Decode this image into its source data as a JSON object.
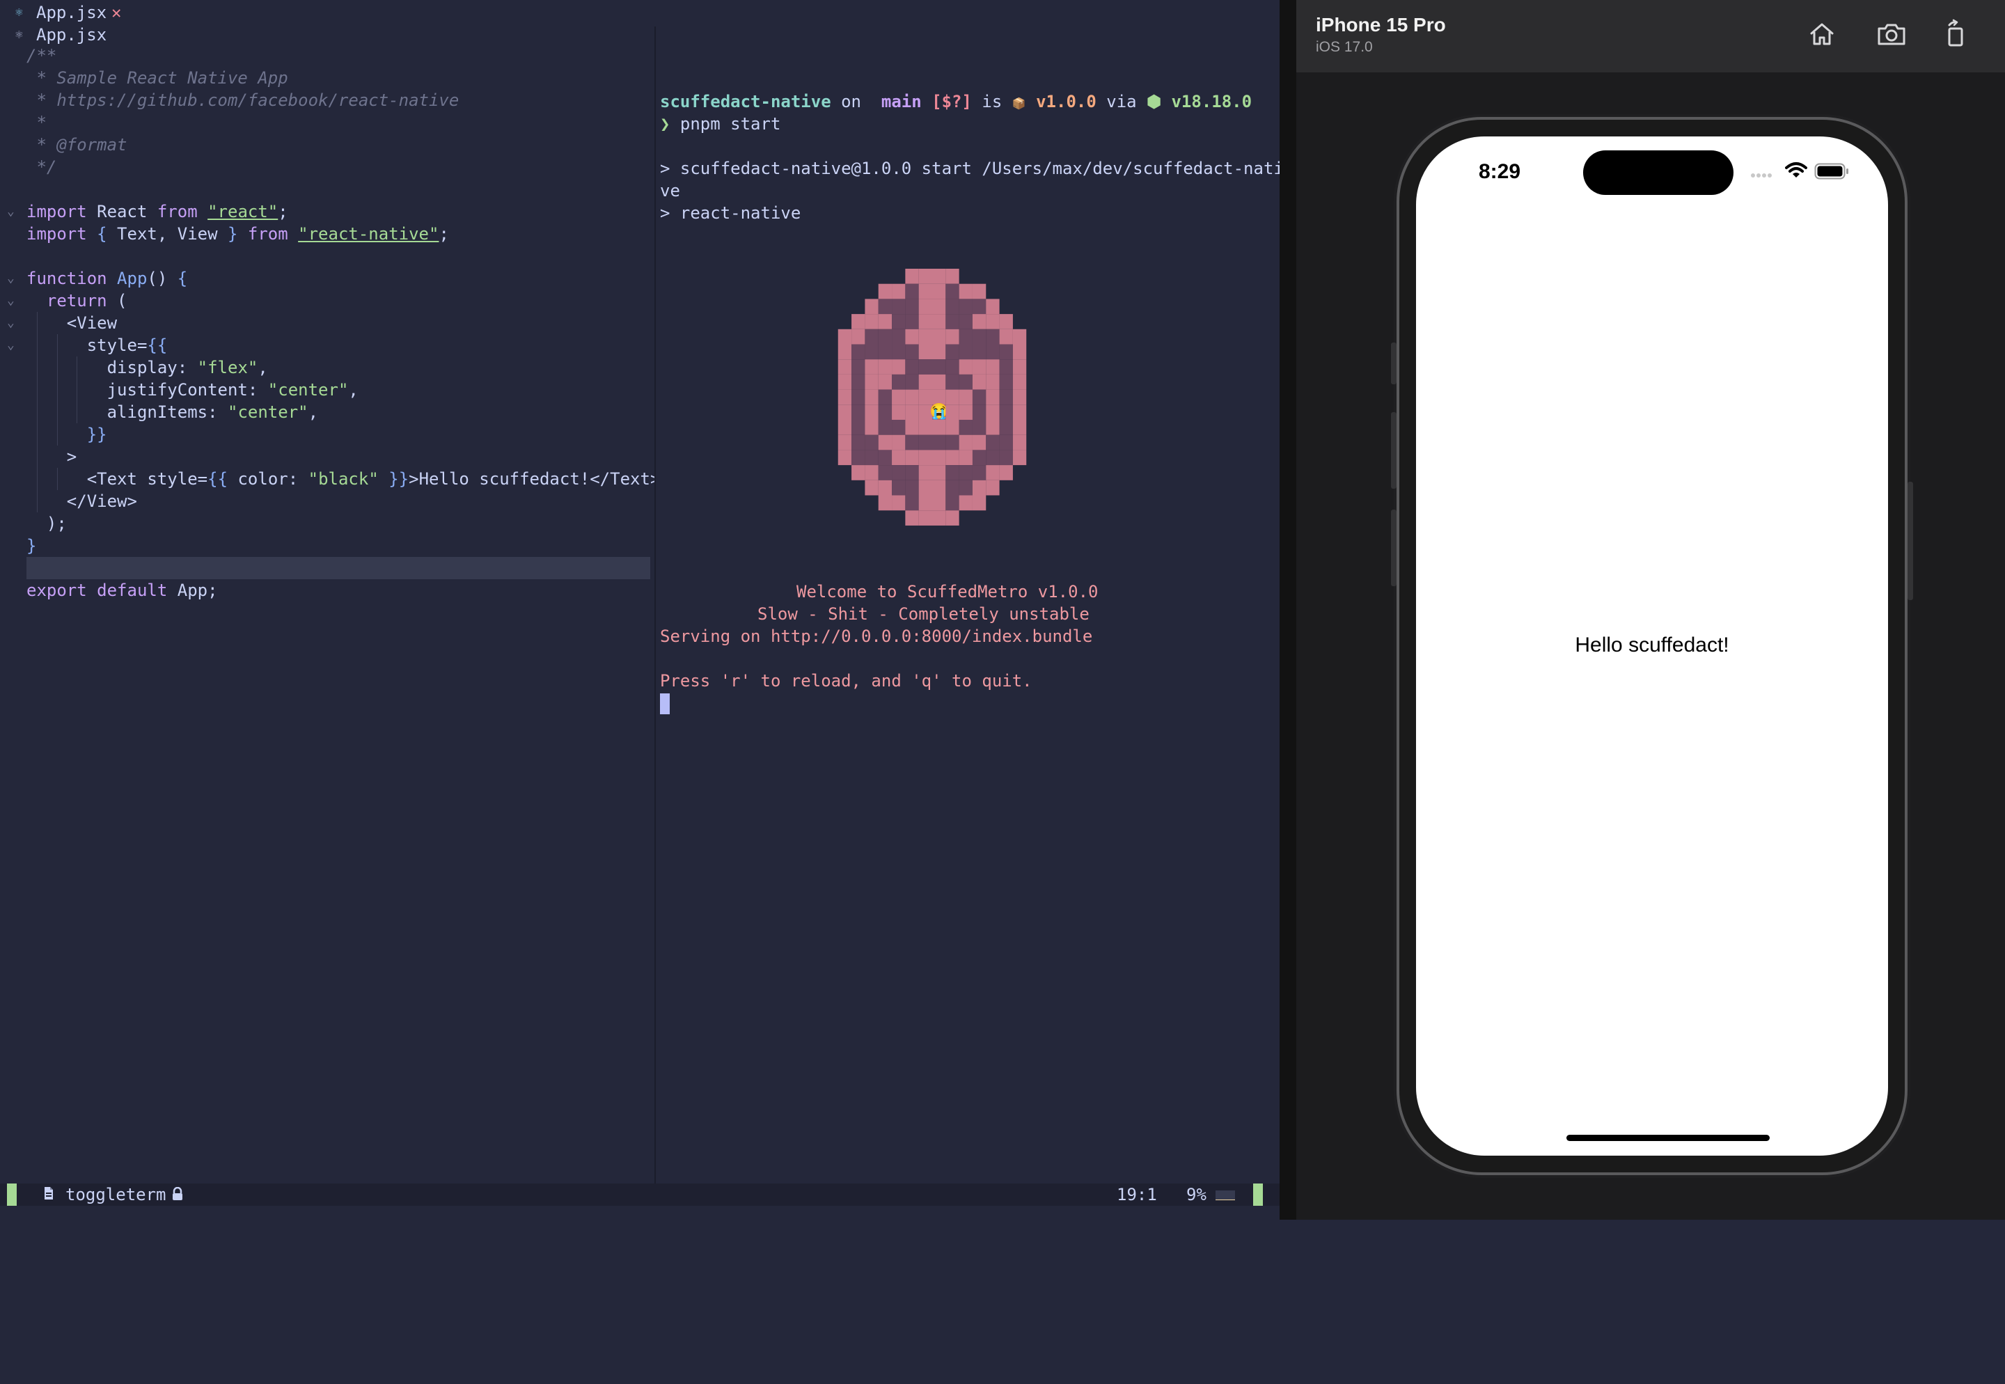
{
  "editor": {
    "tabs": [
      {
        "icon": "react-icon",
        "label": "App.jsx",
        "close": "✕"
      },
      {
        "icon": "react-icon",
        "label": "App.jsx"
      }
    ],
    "lines": [
      "/**",
      " * Sample React Native App",
      " * https://github.com/facebook/react-native",
      " *",
      " * @format",
      " */",
      "",
      "import React from \"react\";",
      "import { Text, View } from \"react-native\";",
      "",
      "function App() {",
      "  return (",
      "    <View",
      "      style={{",
      "        display: \"flex\",",
      "        justifyContent: \"center\",",
      "        alignItems: \"center\",",
      "      }}",
      "    >",
      "      <Text style={{ color: \"black\" }}>Hello scuffedact!</Text>",
      "    </View>",
      "  );",
      "}",
      "",
      "export default App;"
    ]
  },
  "terminal": {
    "prompt": {
      "dir": "scuffedact-native",
      "on": " on ",
      "branch_icon": "",
      "branch": " main",
      "status": " [$?]",
      "is": " is ",
      "pkg_icon": "📦",
      "version": " v1.0.0",
      "via": " via ",
      "node_icon": "⬢",
      "node": " v18.18.0",
      "arrow": "❯",
      "command": " pnpm start"
    },
    "out_1": "> scuffedact-native@1.0.0 start /Users/max/dev/scuffedact-nati",
    "out_2": "ve",
    "out_3": "> react-native",
    "welcome": "Welcome to ScuffedMetro v1.0.0",
    "tagline": "Slow - Shit - Completely unstable",
    "serving": "Serving on http://0.0.0.0:8000/index.bundle",
    "press": "Press 'r' to reload, and 'q' to quit.",
    "art_colors": {
      "light": "#c97a8c",
      "dark": "#6b4760",
      "mid": "#a86478"
    },
    "art_emoji": "😭"
  },
  "statusline": {
    "file": "toggleterm",
    "position": "19:1",
    "percent": "9%",
    "progress": 0.09
  },
  "simulator": {
    "device": "iPhone 15 Pro",
    "os": "iOS 17.0",
    "toolbar": [
      {
        "icon": "home-icon"
      },
      {
        "icon": "screenshot-icon"
      },
      {
        "icon": "rotate-icon"
      }
    ],
    "time": "8:29",
    "content_text": "Hello scuffedact!"
  }
}
